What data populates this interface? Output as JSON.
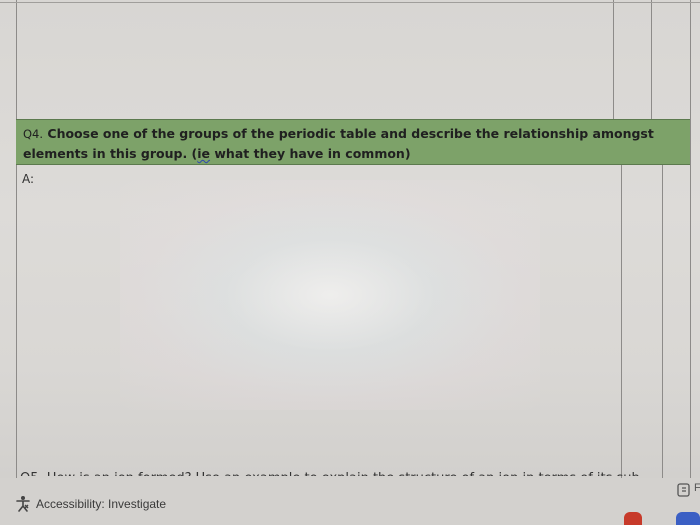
{
  "question": {
    "number": "Q4.",
    "text_before": "Choose one of the groups of the periodic table and describe the relationship amongst elements in this group. (",
    "squiggle_word": "ie",
    "text_after": " what they have in common)"
  },
  "answer": {
    "label": "A:"
  },
  "next_question_partial": "Q5. How is an ion formed? Use an example to explain the structure of an ion in terms of its sub",
  "status_bar": {
    "accessibility_label": "Accessibility: Investigate",
    "accessibility_icon": "accessibility-icon",
    "focus_label": "F"
  },
  "colors": {
    "question_row": "#7da269",
    "squiggle": "#2e46b0"
  }
}
